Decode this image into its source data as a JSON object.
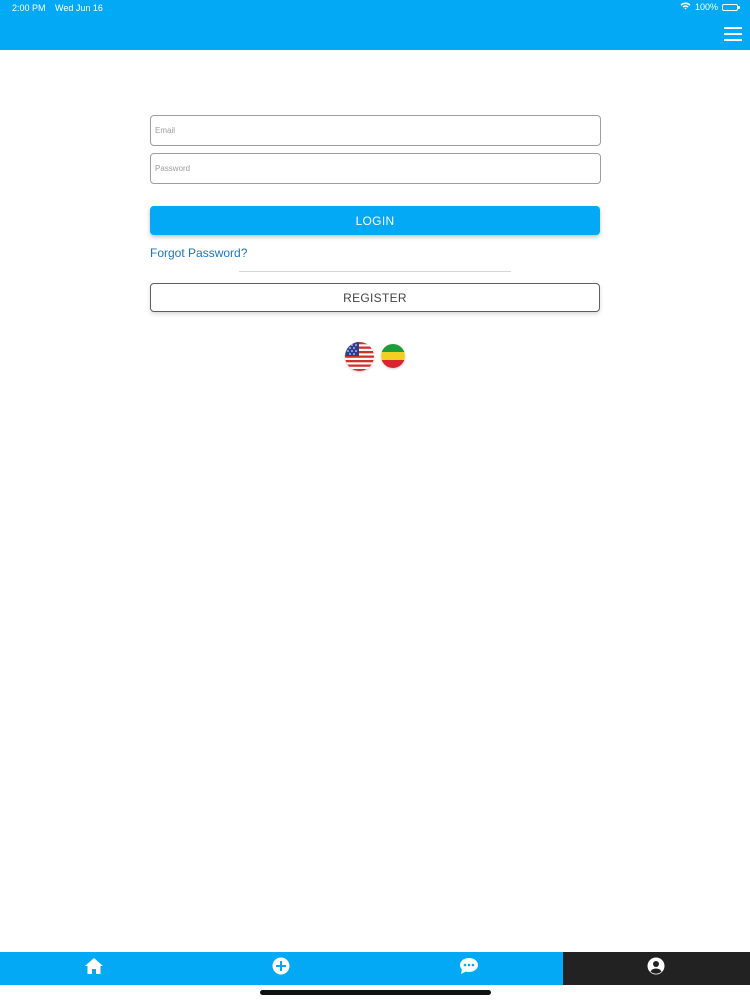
{
  "status_bar": {
    "time": "2:00 PM",
    "date": "Wed Jun 16",
    "battery": "100%",
    "icons": [
      "wifi-icon",
      "battery-icon"
    ]
  },
  "header": {
    "menu_icon": "hamburger-menu-icon"
  },
  "login_form": {
    "email": {
      "placeholder": "Email",
      "value": ""
    },
    "password": {
      "placeholder": "Password",
      "value": ""
    },
    "login_label": "LOGIN",
    "forgot_label": "Forgot Password?",
    "register_label": "REGISTER"
  },
  "languages": [
    {
      "name": "english",
      "icon": "us-flag-icon"
    },
    {
      "name": "amharic",
      "icon": "ethiopia-flag-icon"
    }
  ],
  "tab_bar": {
    "tabs": [
      {
        "name": "home",
        "icon": "home-icon",
        "active": false
      },
      {
        "name": "add",
        "icon": "plus-circle-icon",
        "active": false
      },
      {
        "name": "messages",
        "icon": "chat-bubble-icon",
        "active": false
      },
      {
        "name": "account",
        "icon": "user-circle-icon",
        "active": true
      }
    ]
  },
  "colors": {
    "primary": "#03a9f4",
    "link": "#1e73be",
    "active_tab": "#222222",
    "border": "#9e9e9e"
  }
}
